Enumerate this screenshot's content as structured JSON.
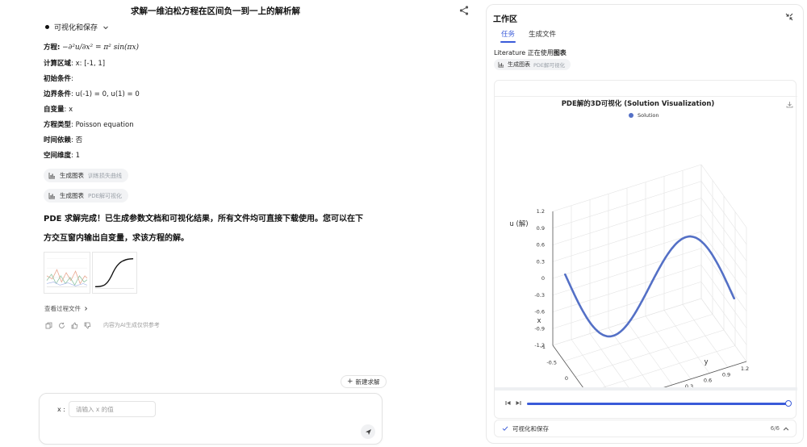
{
  "chat": {
    "title": "求解一维泊松方程在区间负一到一上的解析解",
    "step_label": "可视化和保存",
    "params": [
      {
        "label": "方程",
        "value": ""
      },
      {
        "label": "计算区域",
        "value": "x: [-1, 1]"
      },
      {
        "label": "初始条件",
        "value": ""
      },
      {
        "label": "边界条件",
        "value": "u(-1) = 0, u(1) = 0"
      },
      {
        "label": "自变量",
        "value": "x"
      },
      {
        "label": "方程类型",
        "value": "Poisson equation"
      },
      {
        "label": "时间依赖",
        "value": "否"
      },
      {
        "label": "空间维度",
        "value": "1"
      }
    ],
    "equation_text": "−∂²u/∂x² = π² sin(πx)",
    "chips": [
      {
        "label": "生成图表",
        "sub": "训练损失曲线"
      },
      {
        "label": "生成图表",
        "sub": "PDE解可视化"
      }
    ],
    "answer_line1": "PDE 求解完成！已生成参数文档和可视化结果，所有文件均可直接下载使用。您可以在下",
    "answer_line2": "方交互窗内输出自变量，求该方程的解。",
    "view_files": "查看过程文件",
    "disclaimer": "内容为AI生成仅供参考",
    "new_solve": "新建求解",
    "input_label": "x :",
    "input_placeholder": "请输入 x 的值"
  },
  "workspace": {
    "title": "工作区",
    "tabs": [
      {
        "label": "任务",
        "active": true
      },
      {
        "label": "生成文件",
        "active": false
      }
    ],
    "status_prefix": "Literature 正在使用",
    "status_tool": "图表",
    "chip_label": "生成图表",
    "chip_sub": "PDE解可视化",
    "progress_label": "可视化和保存",
    "progress_count": "6/6"
  },
  "colors": {
    "accent": "#3a5bd9",
    "series": "#5470c6"
  },
  "icons": [
    "share-icon",
    "chevron-down-icon",
    "chart-icon",
    "copy-icon",
    "refresh-icon",
    "thumbs-up-icon",
    "thumbs-down-icon",
    "send-icon",
    "collapse-icon",
    "download-icon",
    "check-icon"
  ],
  "chart_data": {
    "type": "line",
    "title": "PDE解的3D可视化 (Solution Visualization)",
    "series": [
      {
        "name": "Solution",
        "note": "3D curve: x from -1 to 1, y = x, u = sin(pi*x)"
      }
    ],
    "x": [
      -1,
      -0.75,
      -0.5,
      -0.25,
      0,
      0.25,
      0.5,
      0.75,
      1
    ],
    "u": [
      0,
      -0.707,
      -1,
      -0.707,
      0,
      0.707,
      1,
      0.707,
      0
    ],
    "xlabel": "x",
    "ylabel": "y",
    "zlabel": "u (解)",
    "x_ticks": [
      "-1",
      "-0.5",
      "0",
      "0.5",
      "1"
    ],
    "y_ticks": [
      "-1.2",
      "-0.9",
      "-0.6",
      "-0.3",
      "0",
      "0.3",
      "0.6",
      "0.9",
      "1.2"
    ],
    "z_ticks": [
      "1.2",
      "0.9",
      "0.6",
      "0.3",
      "0",
      "-0.3",
      "-0.6",
      "-0.9",
      "-1.2"
    ],
    "player_progress": 1.0
  }
}
